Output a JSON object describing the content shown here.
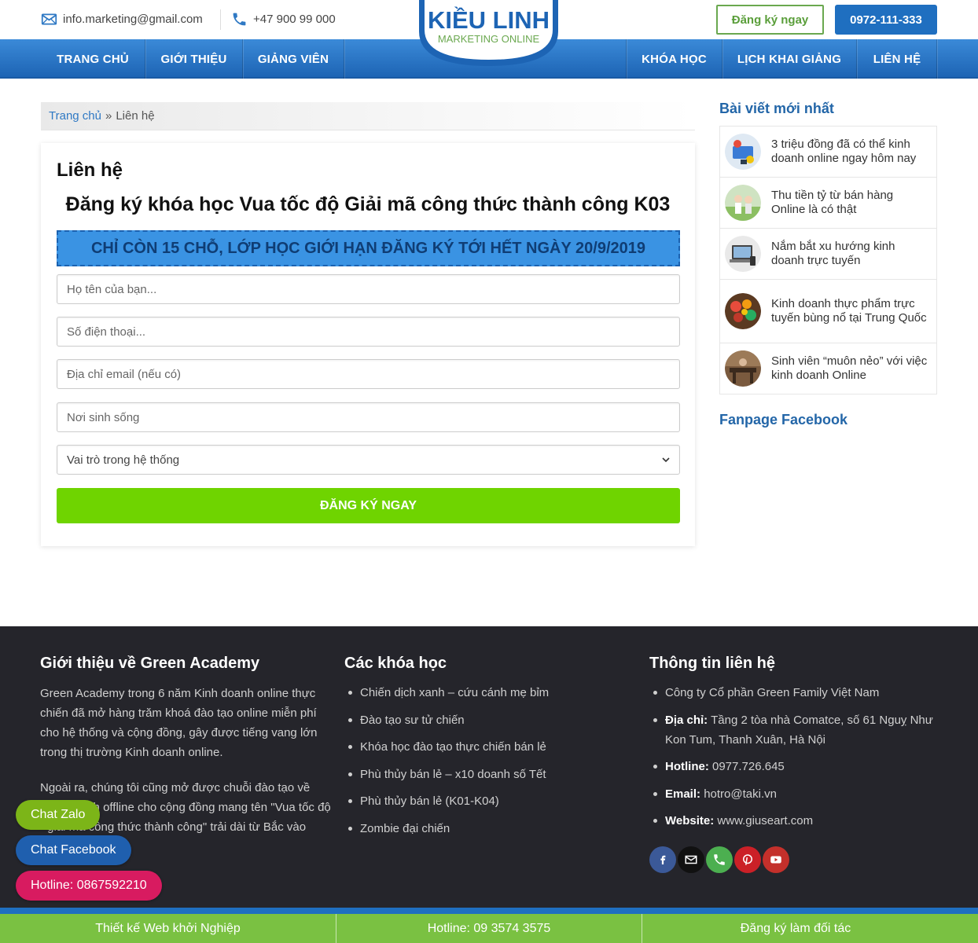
{
  "topbar": {
    "email": "info.marketing@gmail.com",
    "phone": "+47 900 99 000",
    "register_button": "Đăng ký ngay",
    "hotline_button": "0972-111-333"
  },
  "logo": {
    "name": "KIỀU LINH",
    "tagline": "MARKETING ONLINE"
  },
  "nav": {
    "left": [
      "TRANG CHỦ",
      "GIỚI THIỆU",
      "GIẢNG VIÊN"
    ],
    "right": [
      "KHÓA HỌC",
      "LỊCH KHAI GIẢNG",
      "LIÊN HỆ"
    ]
  },
  "breadcrumb": {
    "home": "Trang chủ",
    "separator": "»",
    "current": "Liên hệ"
  },
  "form": {
    "page_title": "Liên hệ",
    "heading": "Đăng ký khóa học Vua tốc độ Giải mã công thức thành công K03",
    "banner": "CHỈ CÒN 15 CHỖ, LỚP HỌC GIỚI HẠN ĐĂNG KÝ TỚI HẾT NGÀY 20/9/2019",
    "name_placeholder": "Họ tên của bạn...",
    "phone_placeholder": "Số điện thoại...",
    "email_placeholder": "Địa chỉ email (nếu có)",
    "location_placeholder": "Nơi sinh sống",
    "role_select": "Vai trò trong hệ thống",
    "submit": "ĐĂNG KÝ NGAY"
  },
  "sidebar": {
    "recent_title": "Bài viết mới nhất",
    "posts": [
      "3 triệu đồng đã có thể kinh doanh online ngay hôm nay",
      "Thu tiền tỷ từ bán hàng Online là có thật",
      "Nắm bắt xu hướng kinh doanh trực tuyến",
      "Kinh doanh thực phẩm trực tuyến bùng nổ tại Trung Quốc",
      "Sinh viên “muôn nẻo” với việc kinh doanh Online"
    ],
    "fanpage_title": "Fanpage Facebook"
  },
  "footer": {
    "about_title": "Giới thiệu về Green Academy",
    "about_p1": "Green Academy trong 6 năm Kinh doanh online thực chiến đã mở hàng trăm khoá đào tạo online miễn phí cho hệ thống và cộng đồng, gây được tiếng vang lớn trong thị trường Kinh doanh online.",
    "about_p2": "Ngoài ra, chúng tôi cũng mở được chuỗi đào tạo về Kinh doanh offline cho cộng đồng mang tên \"Vua tốc độ - giải mã công thức thành công\" trải dài từ Bắc vào",
    "courses_title": "Các khóa học",
    "courses": [
      "Chiến dịch xanh – cứu cánh mẹ bỉm",
      "Đào tạo sư tử chiến",
      "Khóa học đào tạo thực chiến bán lẻ",
      "Phù thủy bán lẻ – x10 doanh số Tết",
      "Phù thủy bán lẻ (K01-K04)",
      "Zombie đại chiến"
    ],
    "contact_title": "Thông tin liên hệ",
    "company": "Công ty Cổ phần Green Family Việt Nam",
    "address_label": "Địa chỉ:",
    "address": "Tầng 2 tòa nhà Comatce, số 61 Nguỵ Như Kon Tum, Thanh Xuân, Hà Nội",
    "hotline_label": "Hotline:",
    "hotline": "0977.726.645",
    "email_label": "Email:",
    "email": "hotro@taki.vn",
    "website_label": "Website:",
    "website": "www.giuseart.com",
    "socials": [
      "facebook-icon",
      "mail-icon",
      "phone-icon",
      "pinterest-icon",
      "youtube-icon"
    ]
  },
  "bottombar": {
    "items": [
      "Thiết kế Web khởi Nghiệp",
      "Hotline: 09 3574 3575",
      "Đăng ký làm đối tác"
    ]
  },
  "floating": {
    "zalo": "Chat Zalo",
    "facebook": "Chat Facebook",
    "hotline": "Hotline: 0867592210"
  },
  "colors": {
    "primary_blue": "#1f6fc0",
    "green_button": "#6fd400",
    "footer_bg": "#25252b",
    "bottom_bar": "#7ac142"
  }
}
